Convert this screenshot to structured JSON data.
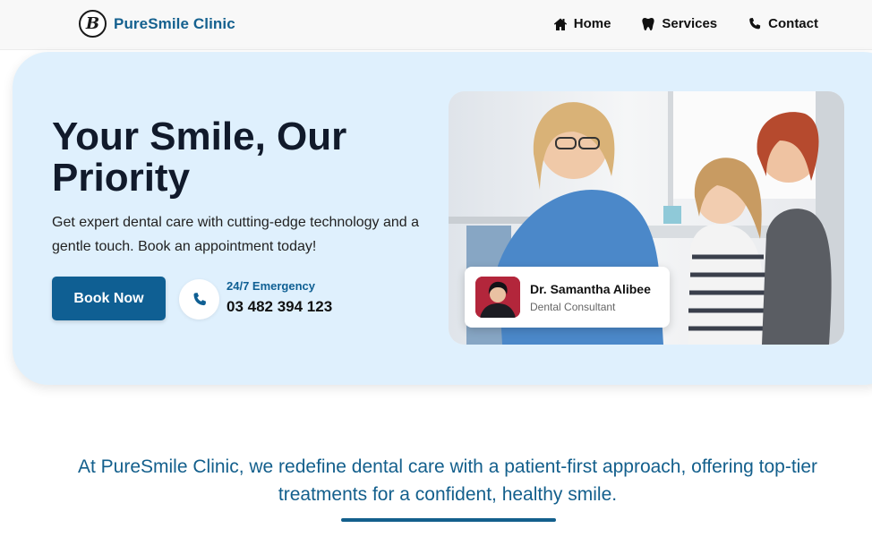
{
  "brand": {
    "logo_letter": "B",
    "name": "PureSmile Clinic"
  },
  "nav": {
    "items": [
      {
        "label": "Home",
        "icon": "home-icon"
      },
      {
        "label": "Services",
        "icon": "tooth-icon"
      },
      {
        "label": "Contact",
        "icon": "phone-icon"
      }
    ]
  },
  "hero": {
    "title": "Your Smile, Our Priority",
    "subtitle": "Get expert dental care with cutting-edge technology and a gentle touch. Book an appointment today!",
    "book_button": "Book Now",
    "emergency_label": "24/7 Emergency",
    "emergency_number": "03 482 394 123",
    "background_color": "#dff0fd"
  },
  "doctor_card": {
    "name": "Dr. Samantha Alibee",
    "role": "Dental Consultant"
  },
  "intro": {
    "text": "At PureSmile Clinic, we redefine dental care with a patient-first approach, offering top-tier treatments for a confident, healthy smile."
  },
  "colors": {
    "accent": "#0f5f93",
    "hero_bg": "#dff0fd",
    "title": "#111a2b"
  }
}
